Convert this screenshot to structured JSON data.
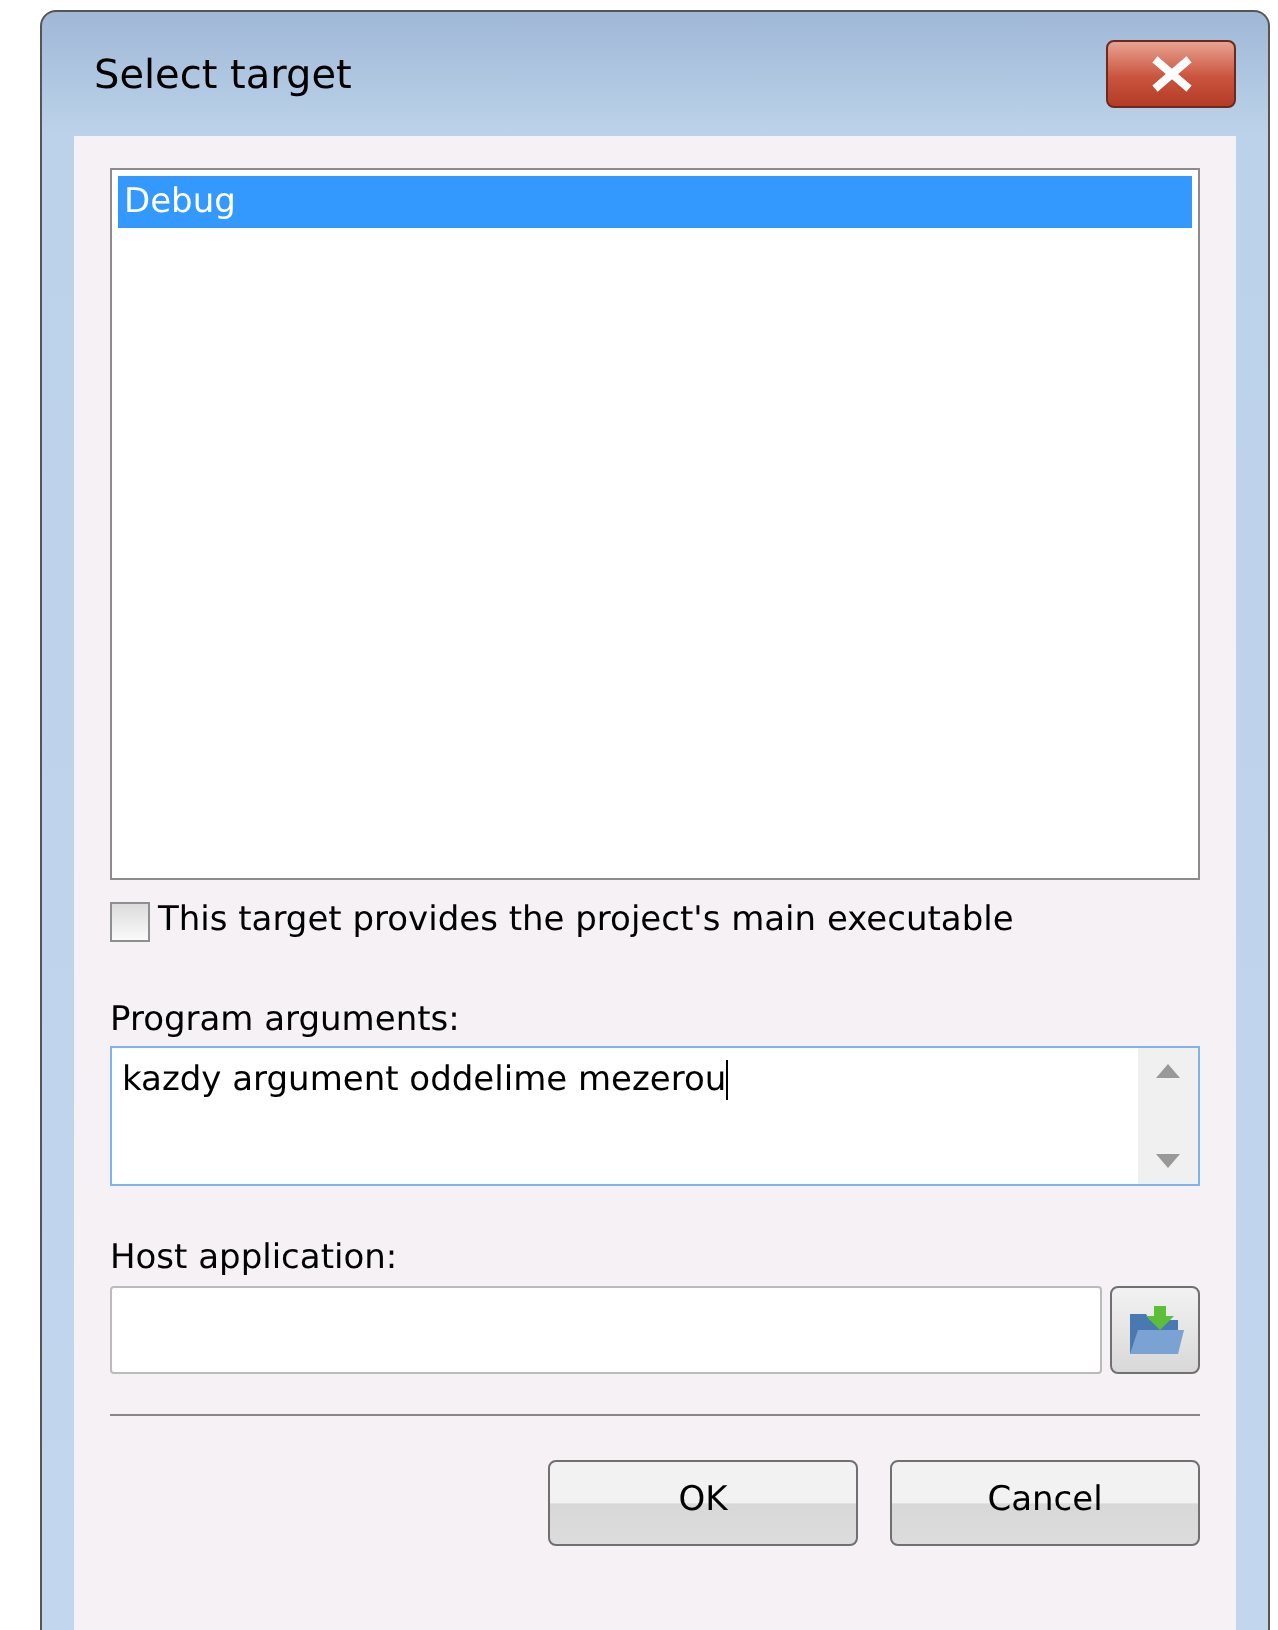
{
  "window": {
    "title": "Select target"
  },
  "targets": [
    {
      "label": "Debug",
      "selected": true
    }
  ],
  "main_executable": {
    "label": "This target provides the project's main executable",
    "checked": false
  },
  "program_arguments": {
    "label": "Program arguments:",
    "value": "kazdy argument oddelime mezerou"
  },
  "host_application": {
    "label": "Host application:"
  },
  "buttons": [
    "OK",
    "Cancel"
  ]
}
